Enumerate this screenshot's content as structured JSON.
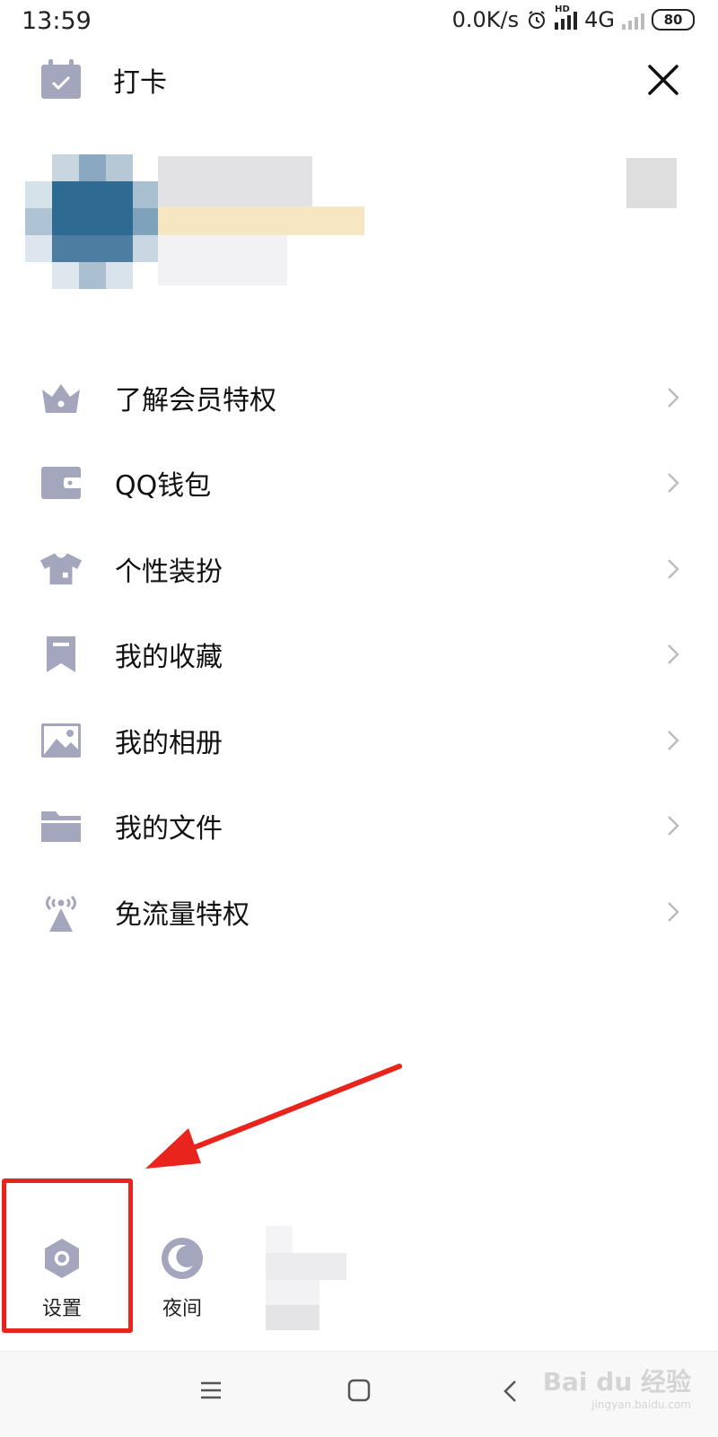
{
  "status_bar": {
    "time": "13:59",
    "net_speed": "0.0K/s",
    "hd_badge": "HD",
    "network": "4G",
    "battery": "80",
    "icons": [
      "alarm-icon",
      "signal-icon",
      "battery-icon"
    ]
  },
  "header": {
    "checkin_label": "打卡",
    "checkin_icon": "calendar-check-icon",
    "close_icon": "close-icon"
  },
  "menu": {
    "items": [
      {
        "label": "了解会员特权",
        "icon": "crown-icon"
      },
      {
        "label": "QQ钱包",
        "icon": "wallet-icon"
      },
      {
        "label": "个性装扮",
        "icon": "shirt-icon"
      },
      {
        "label": "我的收藏",
        "icon": "bookmark-icon"
      },
      {
        "label": "我的相册",
        "icon": "image-icon"
      },
      {
        "label": "我的文件",
        "icon": "folder-icon"
      },
      {
        "label": "免流量特权",
        "icon": "broadcast-icon"
      }
    ]
  },
  "bottom": {
    "settings_label": "设置",
    "night_label": "夜间"
  },
  "watermark": {
    "brand": "Bai du 经验",
    "url": "jingyan.baidu.com"
  },
  "colors": {
    "icon": "#a3a6bd",
    "annotation": "#e8241c",
    "text": "#111111"
  }
}
